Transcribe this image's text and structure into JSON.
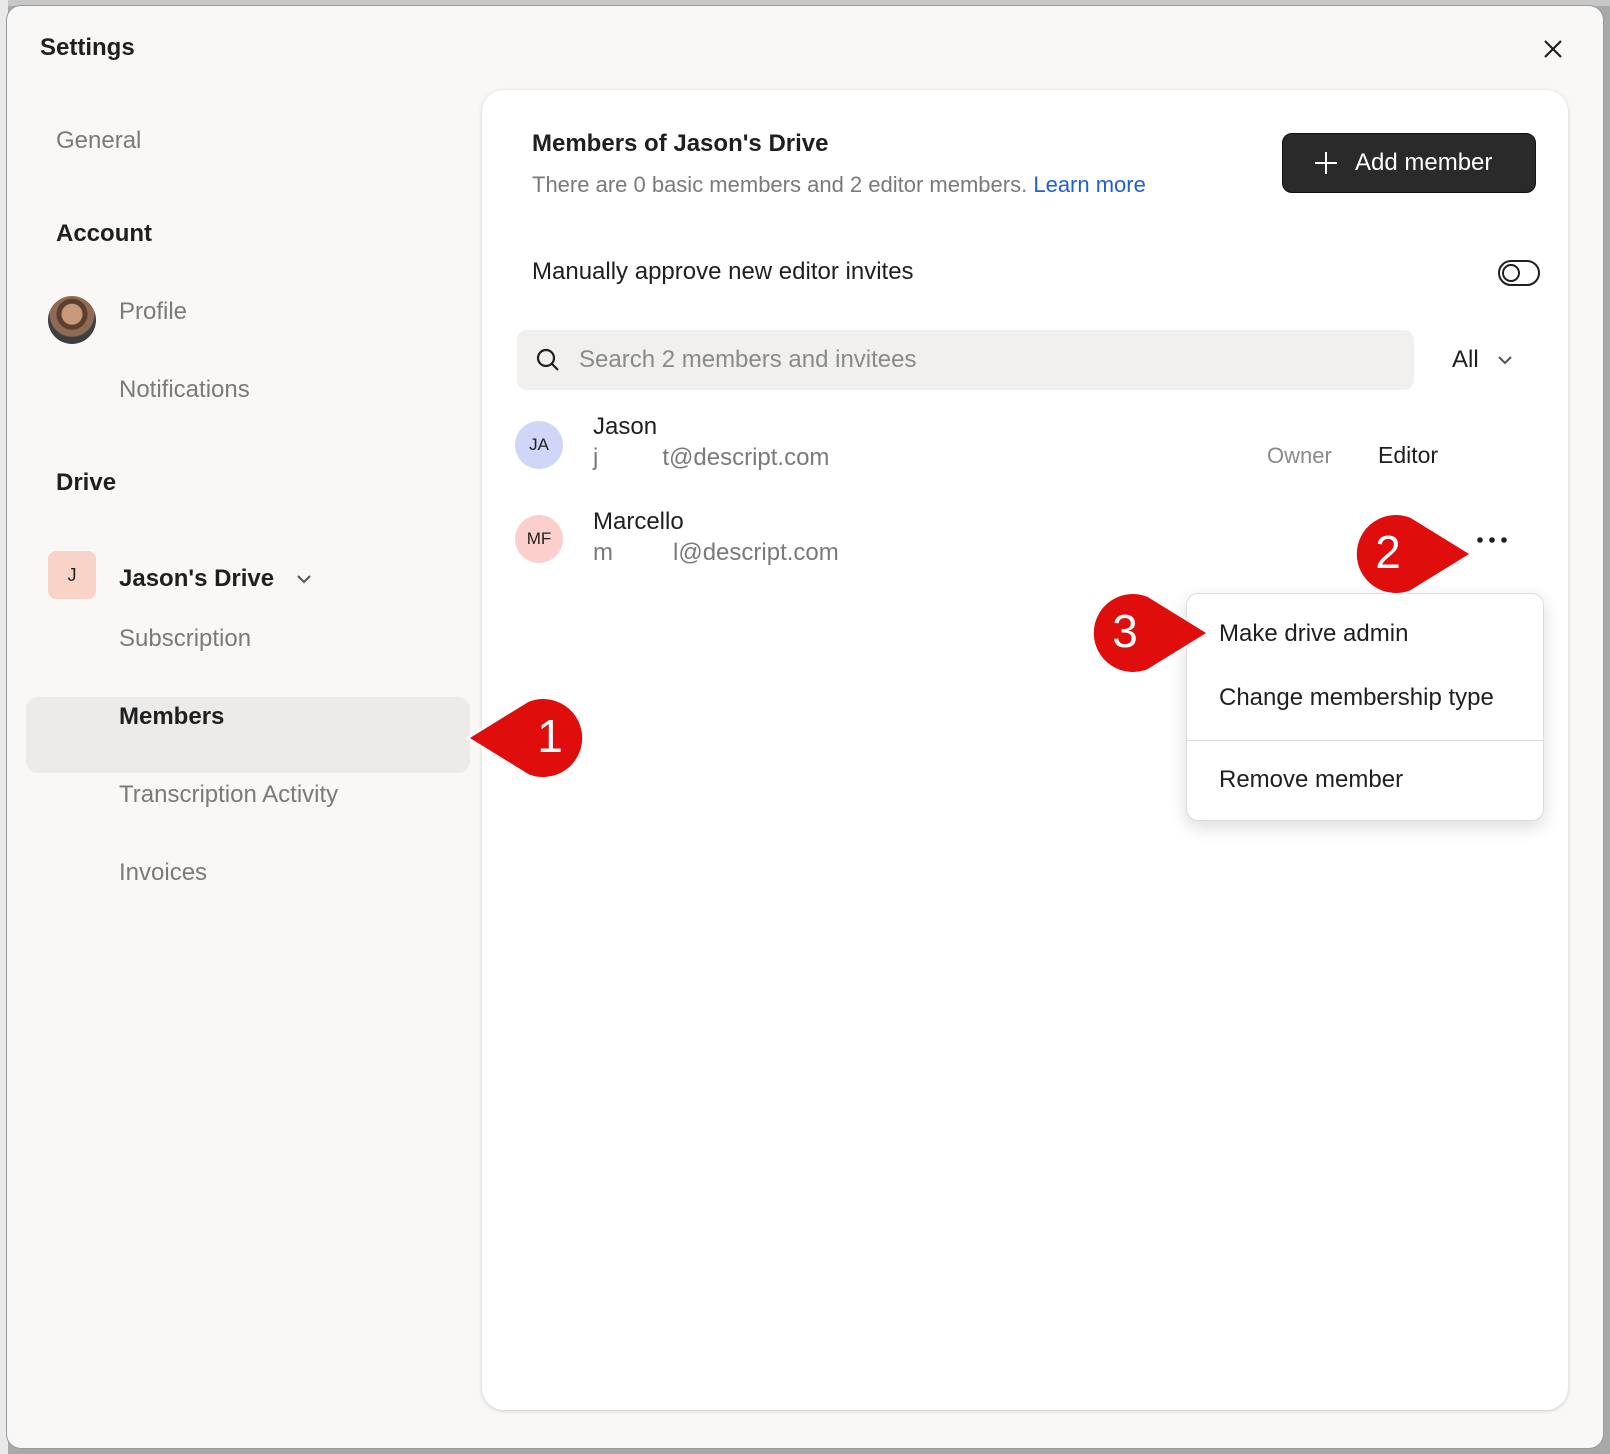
{
  "modal": {
    "title": "Settings"
  },
  "sidebar": {
    "general": "General",
    "account_section": "Account",
    "profile": "Profile",
    "notifications": "Notifications",
    "drive_section": "Drive",
    "drive_badge": "J",
    "drive_name": "Jason's Drive",
    "subscription": "Subscription",
    "members": "Members",
    "transcription": "Transcription Activity",
    "invoices": "Invoices"
  },
  "main": {
    "title": "Members of Jason's Drive",
    "subtitle": "There are 0 basic members and 2 editor members.",
    "learn_more": "Learn more",
    "add_member": "Add member",
    "approve_label": "Manually approve new editor invites",
    "approve_enabled": false,
    "search_placeholder": "Search 2 members and invitees",
    "filter_value": "All",
    "members": [
      {
        "initials": "JA",
        "name": "Jason",
        "email_start": "j",
        "email_end": "t@descript.com",
        "tag": "Owner",
        "role": "Editor",
        "avatar_color": "#cfd6f7"
      },
      {
        "initials": "MF",
        "name": "Marcello",
        "email_start": "m",
        "email_end": "l@descript.com",
        "avatar_color": "#fbd0cc"
      }
    ]
  },
  "menu": {
    "items": [
      "Make drive admin",
      "Change membership type",
      "Remove member"
    ]
  },
  "callouts": [
    "1",
    "2",
    "3"
  ],
  "colors": {
    "callout": "#e00d0d",
    "link": "#1f5fd6",
    "button": "#2a2a2a"
  }
}
